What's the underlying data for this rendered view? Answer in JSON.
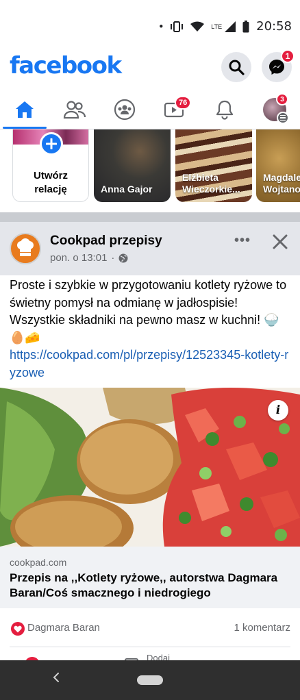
{
  "status_bar": {
    "time": "20:58",
    "network": "LTE"
  },
  "header": {
    "logo": "facebook",
    "messenger_badge": "1",
    "brand_color": "#1877f2"
  },
  "tabs": [
    {
      "name": "home",
      "icon": "home-icon",
      "active": true
    },
    {
      "name": "friends",
      "icon": "friends-icon"
    },
    {
      "name": "groups",
      "icon": "groups-icon"
    },
    {
      "name": "watch",
      "icon": "watch-icon",
      "badge": "76"
    },
    {
      "name": "notifications",
      "icon": "bell-icon"
    },
    {
      "name": "menu",
      "icon": "profile-menu-icon",
      "badge": "3"
    }
  ],
  "stories": {
    "create_label": "Utwórz relację",
    "items": [
      {
        "name": "Anna Gajor"
      },
      {
        "name": "Elżbieta Wieczorkie..."
      },
      {
        "name": "Magdalena Wojtano..."
      }
    ]
  },
  "post": {
    "page_name": "Cookpad przepisy",
    "time": "ponon. o 13:01",
    "time_label": "pon. o 13:01",
    "privacy_icon": "globe-icon",
    "text": "Proste i szybkie w przygotowaniu kotlety ryżowe to świetny pomysł na odmianę w jadłospisie! Wszystkie składniki na pewno masz w kuchni! 🍚🥚🧀",
    "link": "https://cookpad.com/pl/przepisy/12523345-kotlety-ryzowe",
    "preview": {
      "domain": "cookpad.com",
      "title": "Przepis na ,,Kotlety ryżowe,, autorstwa Dagmara Baran/Coś smacznego i niedrogiego"
    },
    "reaction_name": "Dagmara Baran",
    "comment_count": "1 komentarz",
    "actions": {
      "comment": "Dodaj"
    }
  },
  "colors": {
    "badge": "#e41e3f",
    "link": "#1a5fb4",
    "header_bg": "#e4e6eb"
  }
}
